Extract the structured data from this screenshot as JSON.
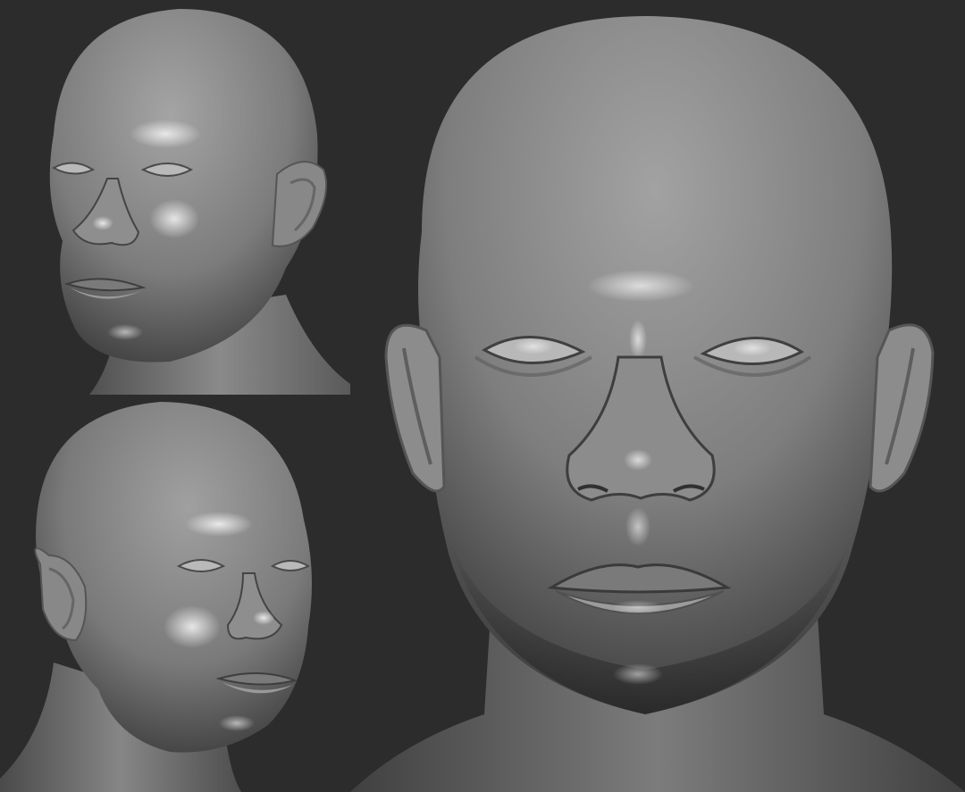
{
  "scene": {
    "background_color": "#2c2c2c",
    "clay_color": "#8a8a8a",
    "clay_highlight": "#d8d8d8",
    "clay_shadow": "#3a3a3a"
  },
  "views": [
    {
      "name": "three-quarter-left-view",
      "icon": "head-sculpt-icon"
    },
    {
      "name": "three-quarter-right-view",
      "icon": "head-sculpt-icon"
    },
    {
      "name": "front-view",
      "icon": "head-sculpt-icon"
    }
  ]
}
